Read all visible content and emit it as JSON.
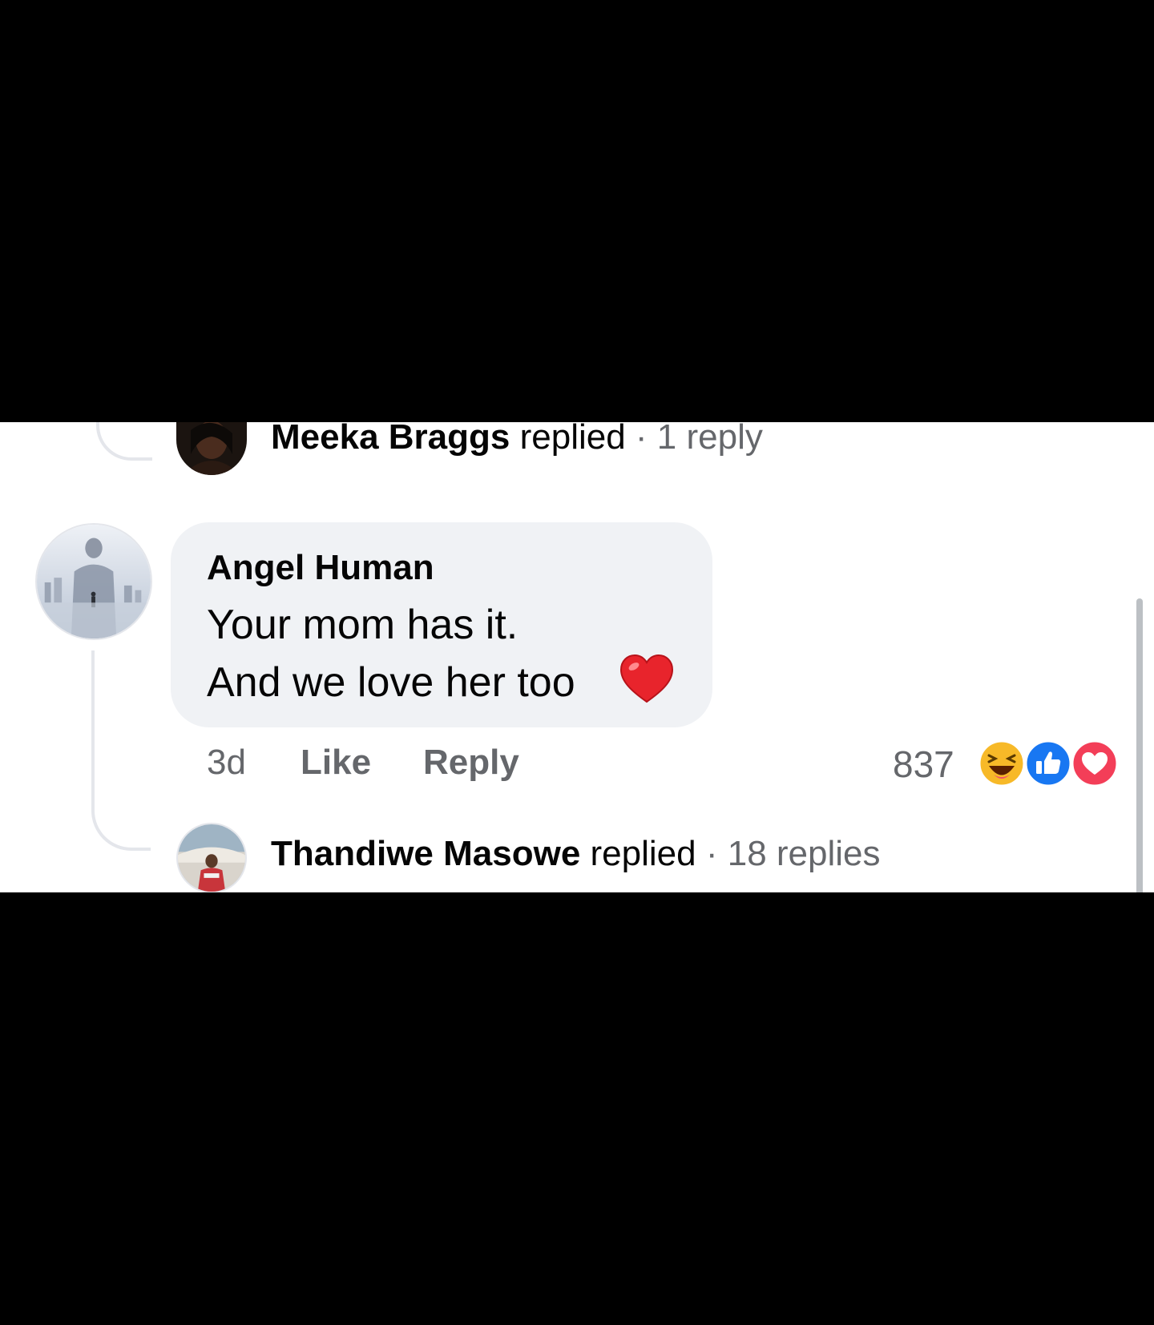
{
  "thread": {
    "reply_top": {
      "name": "Meeka Braggs",
      "verb": "replied",
      "meta": "· 1 reply"
    },
    "comment": {
      "author": "Angel Human",
      "lines": [
        "Your mom has it.",
        "And we love her too"
      ],
      "emoji": "heart-emoji",
      "time": "3d",
      "like_label": "Like",
      "reply_label": "Reply",
      "reaction_count": "837",
      "reactions": [
        "haha-icon",
        "like-icon",
        "love-icon"
      ]
    },
    "reply_bottom": {
      "name": "Thandiwe Masowe",
      "verb": "replied",
      "meta": "· 18 replies"
    }
  },
  "colors": {
    "background": "#000000",
    "panel": "#ffffff",
    "bubble": "#f0f2f5",
    "primary_text": "#050505",
    "secondary_text": "#65676b",
    "like_blue": "#1877f2",
    "love_red": "#f33e58",
    "haha_yellow": "#f7b928"
  }
}
